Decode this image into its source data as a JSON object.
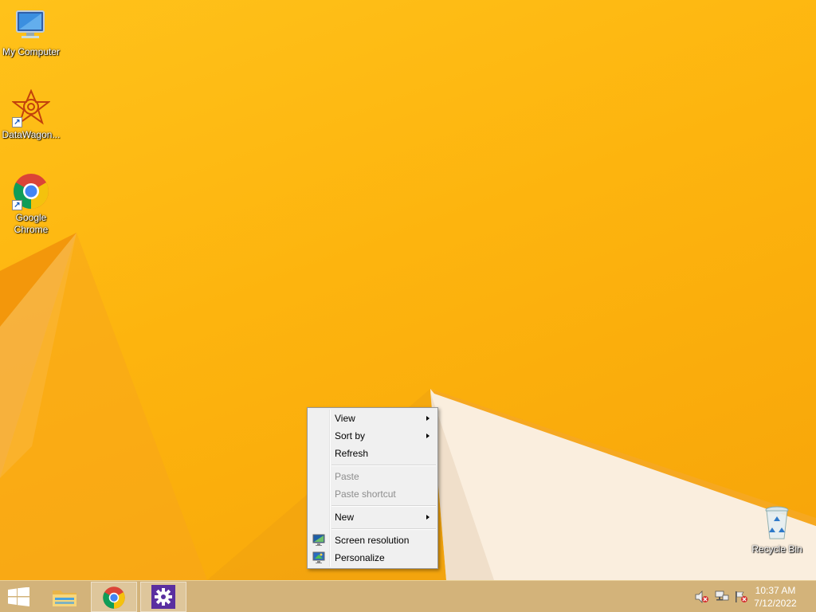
{
  "desktop": {
    "icons": [
      {
        "label": "My Computer",
        "icon": "my-computer-icon"
      },
      {
        "label": "DataWagon...",
        "icon": "datawagon-icon"
      },
      {
        "label": "Google Chrome",
        "icon": "chrome-icon"
      },
      {
        "label": "Recycle Bin",
        "icon": "recycle-bin-icon"
      }
    ]
  },
  "context_menu": {
    "items": [
      {
        "label": "View",
        "submenu": true,
        "enabled": true
      },
      {
        "label": "Sort by",
        "submenu": true,
        "enabled": true
      },
      {
        "label": "Refresh",
        "submenu": false,
        "enabled": true
      },
      {
        "label": "Paste",
        "submenu": false,
        "enabled": false
      },
      {
        "label": "Paste shortcut",
        "submenu": false,
        "enabled": false
      },
      {
        "label": "New",
        "submenu": true,
        "enabled": true
      },
      {
        "label": "Screen resolution",
        "submenu": false,
        "enabled": true,
        "icon": "screen-resolution-icon"
      },
      {
        "label": "Personalize",
        "submenu": false,
        "enabled": true,
        "icon": "personalize-icon"
      }
    ]
  },
  "taskbar": {
    "buttons": [
      {
        "name": "start",
        "icon": "windows-logo-icon"
      },
      {
        "name": "file-explorer",
        "icon": "folder-icon"
      },
      {
        "name": "chrome",
        "icon": "chrome-icon",
        "active": true
      },
      {
        "name": "settings",
        "icon": "gear-icon",
        "active": true
      }
    ],
    "tray": [
      "volume-muted-icon",
      "network-icon",
      "action-center-flag-icon"
    ],
    "clock": {
      "time": "10:37 AM",
      "date": "7/12/2022"
    }
  },
  "colors": {
    "desktop_background": "#fdb40e",
    "menu_background": "#f0f0f0",
    "disabled_text": "#8d8d8d"
  }
}
